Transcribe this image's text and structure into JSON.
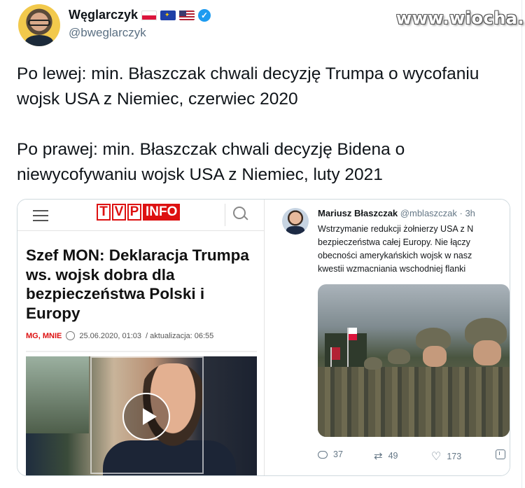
{
  "watermark": "www.wiocha.pl",
  "author": {
    "display_name": "Węglarczyk",
    "handle": "@bweglarczyk",
    "flags": [
      "flag-pl",
      "flag-eu",
      "flag-us"
    ],
    "verified_badge": "✓"
  },
  "tweet": {
    "line1": "Po lewej: min. Błaszczak chwali decyzję Trumpa o wycofaniu wojsk USA z Niemiec, czerwiec 2020",
    "line2": "Po prawej: min. Błaszczak chwali decyzję Bidena o niewycofywaniu wojsk USA z Niemiec, luty 2021"
  },
  "left_article": {
    "logo_letters": [
      "T",
      "V",
      "P"
    ],
    "logo_info": "INFO",
    "headline": "Szef MON: Deklaracja Trumpa ws. wojsk dobra dla bezpieczeństwa Polski i Europy",
    "tags": "MG, MNIE",
    "date": "25.06.2020, 01:03",
    "updated": "/ aktualizacja: 06:55"
  },
  "right_tweet": {
    "name": "Mariusz Błaszczak",
    "handle": "@mblaszczak · 3h",
    "lines": [
      "Wstrzymanie redukcji żołnierzy USA z N",
      "bezpieczeństwa całej Europy. Nie łączy",
      "obecności amerykańskich wojsk w nasz",
      "kwestii wzmacniania wschodniej flanki"
    ],
    "replies": "37",
    "retweets": "49",
    "likes": "173"
  },
  "colors": {
    "tvp_red": "#dd1111",
    "twitter_blue": "#1d9bf0",
    "muted_text": "#5b7083"
  }
}
